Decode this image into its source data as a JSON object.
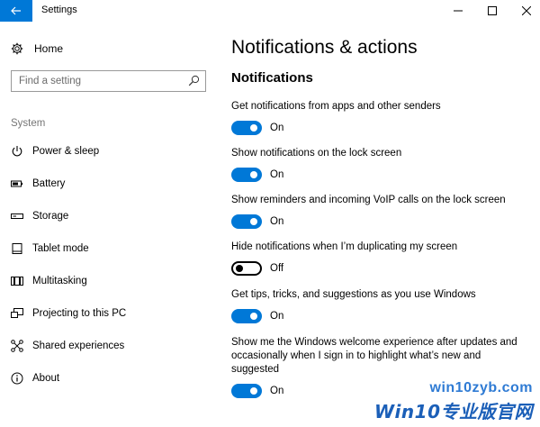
{
  "window": {
    "title": "Settings"
  },
  "sidebar": {
    "home_label": "Home",
    "search_placeholder": "Find a setting",
    "section_label": "System",
    "items": [
      {
        "label": "Power & sleep",
        "icon": "power-icon"
      },
      {
        "label": "Battery",
        "icon": "battery-icon"
      },
      {
        "label": "Storage",
        "icon": "storage-icon"
      },
      {
        "label": "Tablet mode",
        "icon": "tablet-icon"
      },
      {
        "label": "Multitasking",
        "icon": "multitasking-icon"
      },
      {
        "label": "Projecting to this PC",
        "icon": "projecting-icon"
      },
      {
        "label": "Shared experiences",
        "icon": "shared-icon"
      },
      {
        "label": "About",
        "icon": "info-icon"
      }
    ]
  },
  "main": {
    "title": "Notifications & actions",
    "section_title": "Notifications",
    "settings": [
      {
        "label": "Get notifications from apps and other senders",
        "state": "On",
        "on": true
      },
      {
        "label": "Show notifications on the lock screen",
        "state": "On",
        "on": true
      },
      {
        "label": "Show reminders and incoming VoIP calls on the lock screen",
        "state": "On",
        "on": true
      },
      {
        "label": "Hide notifications when I’m duplicating my screen",
        "state": "Off",
        "on": false
      },
      {
        "label": "Get tips, tricks, and suggestions as you use Windows",
        "state": "On",
        "on": true
      },
      {
        "label": "Show me the Windows welcome experience after updates and occasionally when I sign in to highlight what’s new and suggested",
        "state": "On",
        "on": true
      }
    ]
  },
  "watermark": {
    "url": "win10zyb.com",
    "brand": "Win10专业版官网"
  },
  "colors": {
    "accent": "#0078d7",
    "section_gray": "#767676"
  }
}
